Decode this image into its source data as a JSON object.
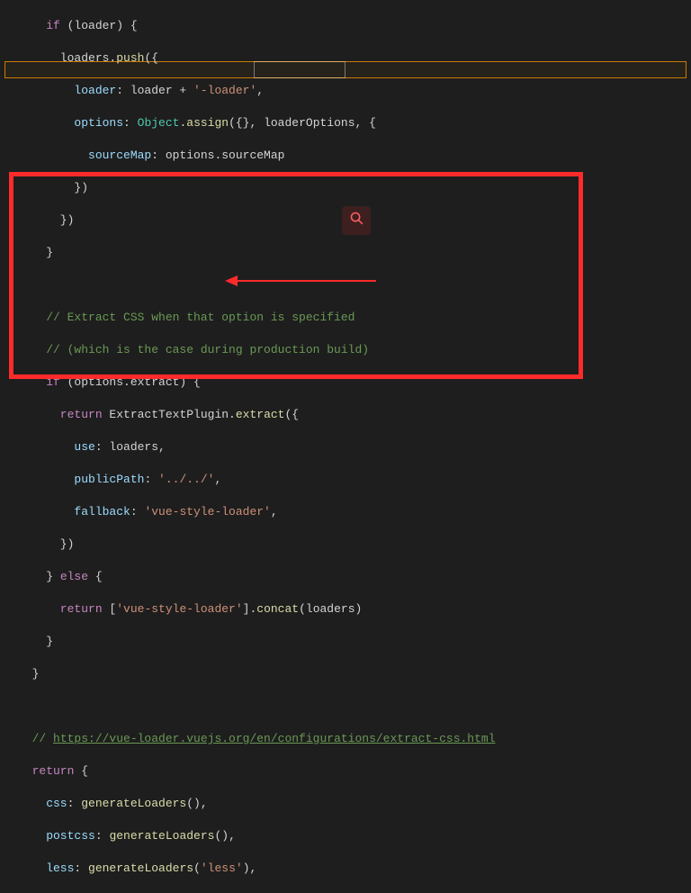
{
  "code": {
    "l1a": "    if",
    "l1b": " (loader) {",
    "l2a": "      loaders.",
    "l2b": "push",
    "l2c": "({",
    "l3a": "        loader",
    "l3b": ": loader + ",
    "l3c": "'-loader'",
    "l3d": ",",
    "l4a": "        options",
    "l4b": ": ",
    "l4c": "Object",
    "l4d": ".",
    "l4e": "assign",
    "l4f": "({}, loaderOptions, {",
    "l5a": "          sourceMap",
    "l5b": ": options.sourceMap",
    "l6": "        })",
    "l7": "      })",
    "l8": "    }",
    "l9": "",
    "l10a": "    // Extract CSS when that option is specified",
    "l11a": "    // (which is the case during production build)",
    "l12a": "    if",
    "l12b": " (options.extract) {",
    "l13a": "      return",
    "l13b": " ExtractTextPlugin.",
    "l13c": "extract",
    "l13d": "({",
    "l14a": "        use",
    "l14b": ": loaders,",
    "l15a": "        publicPath",
    "l15b": ": ",
    "l15c": "'../../'",
    "l15d": ",",
    "l16a": "        fallback",
    "l16b": ": ",
    "l16c": "'vue-style-loader'",
    "l16d": ",",
    "l17": "      })",
    "l18a": "    } ",
    "l18b": "else",
    "l18c": " {",
    "l19a": "      return",
    "l19b": " [",
    "l19c": "'vue-style-loader'",
    "l19d": "].",
    "l19e": "concat",
    "l19f": "(loaders)",
    "l20": "    }",
    "l21": "  }",
    "l22": "",
    "l23a": "  // ",
    "l23b": "https://vue-loader.vuejs.org/en/configurations/extract-css.html",
    "l24a": "  return",
    "l24b": " {",
    "l25a": "    css",
    "l25b": ": ",
    "l25c": "generateLoaders",
    "l25d": "(),",
    "l26a": "    postcss",
    "l26b": ": ",
    "l26c": "generateLoaders",
    "l26d": "(),",
    "l27a": "    less",
    "l27b": ": ",
    "l27c": "generateLoaders",
    "l27d": "(",
    "l27e": "'less'",
    "l27f": "),"
  }
}
